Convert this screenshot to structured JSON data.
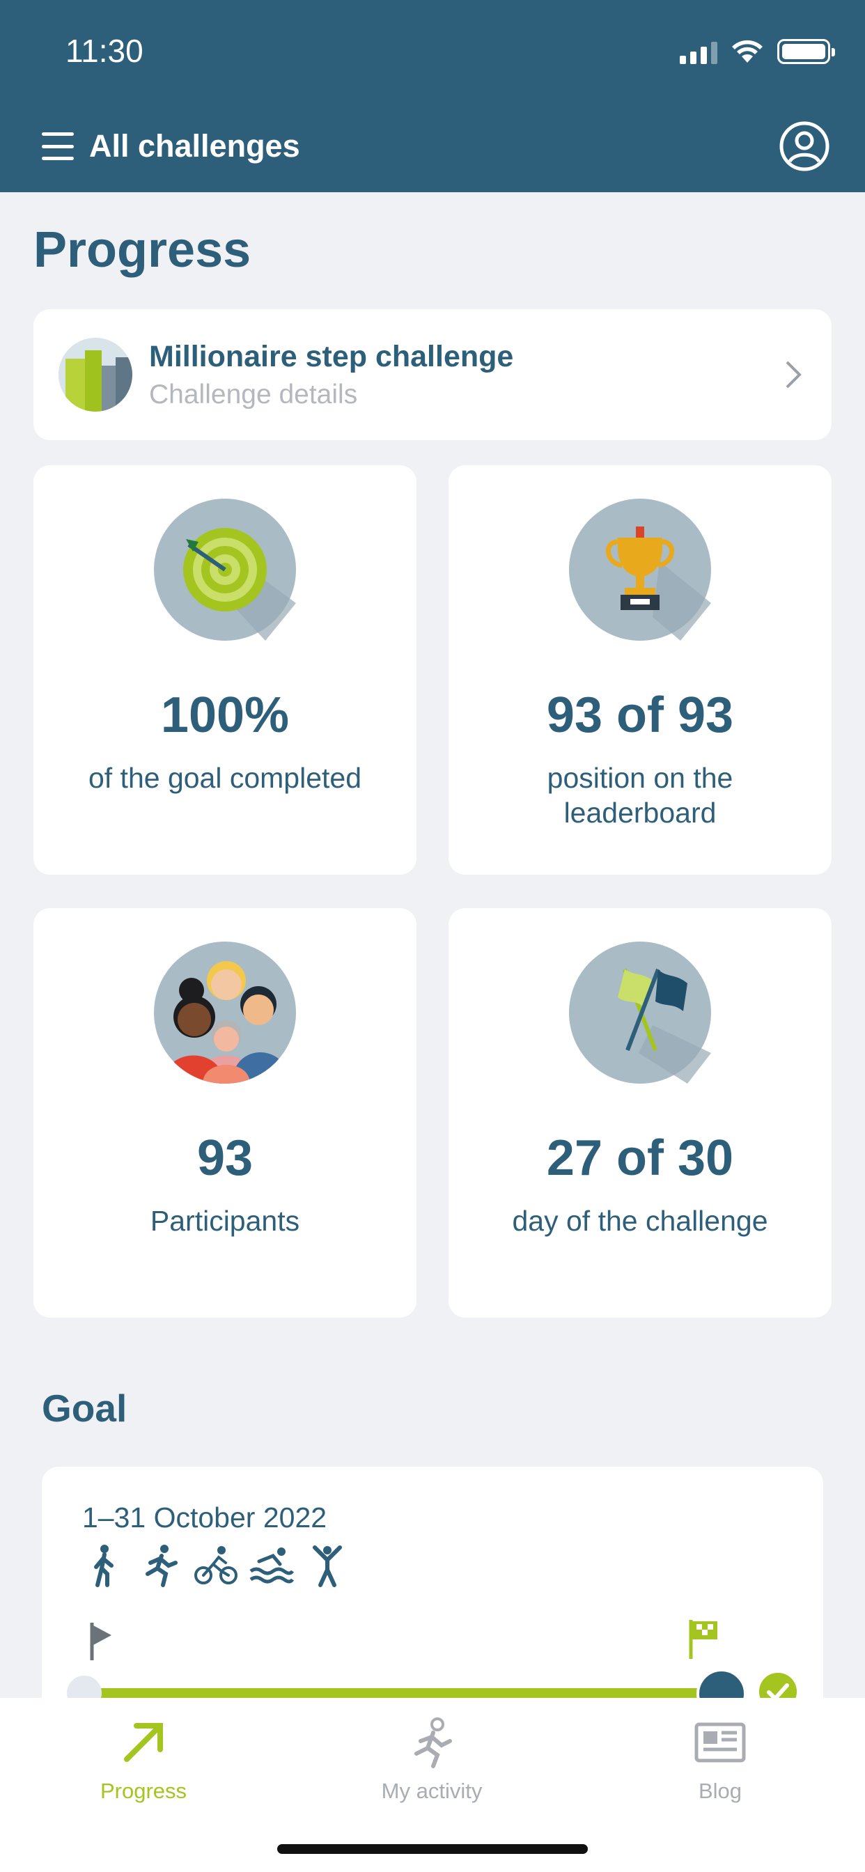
{
  "status_bar": {
    "time": "11:30"
  },
  "nav": {
    "title": "All challenges"
  },
  "page": {
    "title": "Progress"
  },
  "challenge": {
    "name": "Millionaire step challenge",
    "details_link": "Challenge details"
  },
  "stats": [
    {
      "value": "100%",
      "label": "of the goal completed",
      "icon": "target-icon"
    },
    {
      "value": "93 of 93",
      "label": "position on the leaderboard",
      "icon": "trophy-icon"
    },
    {
      "value": "93",
      "label": "Participants",
      "icon": "participants-icon"
    },
    {
      "value": "27 of 30",
      "label": "day of the challenge",
      "icon": "flags-icon"
    }
  ],
  "goal": {
    "heading": "Goal",
    "date_range": "1–31 October 2022",
    "activities": [
      "walk-icon",
      "run-icon",
      "bike-icon",
      "swim-icon",
      "fitness-icon"
    ],
    "progress": 1.0
  },
  "tabs": [
    {
      "label": "Progress",
      "icon": "arrow-up-right-icon",
      "active": true
    },
    {
      "label": "My activity",
      "icon": "runner-icon",
      "active": false
    },
    {
      "label": "Blog",
      "icon": "newspaper-icon",
      "active": false
    }
  ],
  "colors": {
    "primary": "#2e5f7a",
    "accent": "#a4c520",
    "background": "#f0f1f5",
    "muted": "#b4b8be"
  }
}
